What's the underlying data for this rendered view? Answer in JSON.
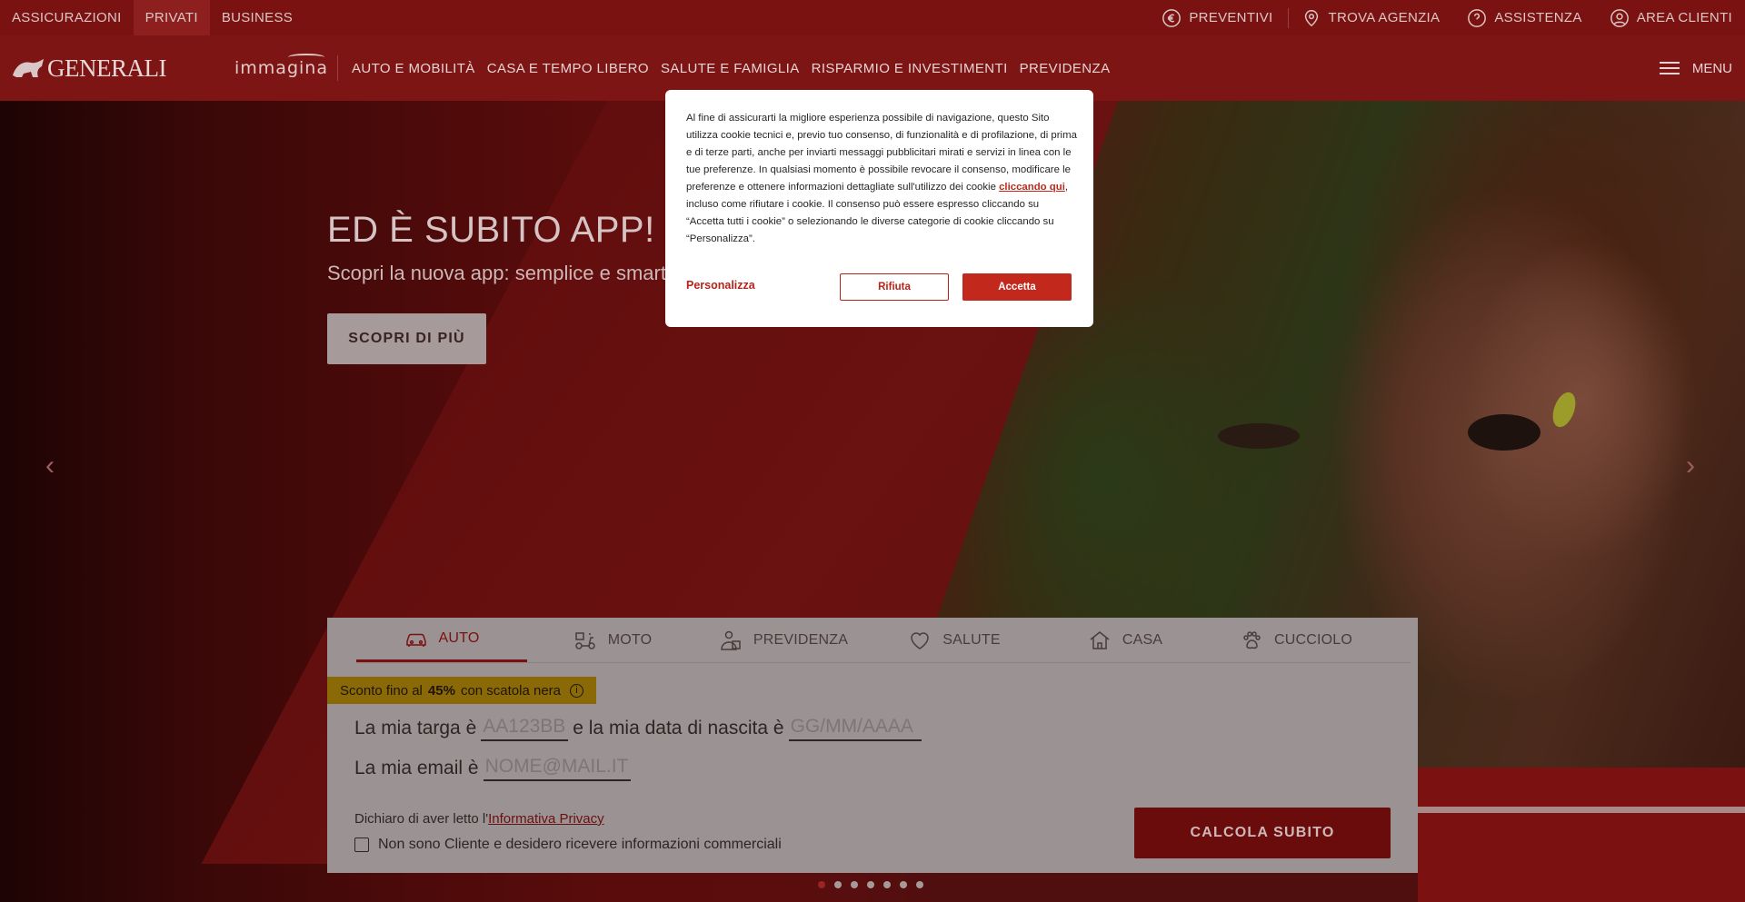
{
  "topbar": {
    "left": [
      "ASSICURAZIONI",
      "PRIVATI",
      "BUSINESS"
    ],
    "right": {
      "preventivi": "PREVENTIVI",
      "trova_agenzia": "TROVA AGENZIA",
      "assistenza": "ASSISTENZA",
      "area_clienti": "AREA CLIENTI"
    }
  },
  "nav": {
    "logo": "GENERALI",
    "immagina": "immagina",
    "links": [
      "AUTO E MOBILITÀ",
      "CASA E TEMPO LIBERO",
      "SALUTE E FAMIGLIA",
      "RISPARMIO E INVESTIMENTI",
      "PREVIDENZA"
    ],
    "menu": "MENU"
  },
  "hero": {
    "title": "ED È SUBITO APP!",
    "subtitle": "Scopri la nuova app: semplice e smart,",
    "cta": "SCOPRI DI PIÙ",
    "prev_arrow": "‹",
    "next_arrow": "›"
  },
  "quote": {
    "tabs": [
      "AUTO",
      "MOTO",
      "PREVIDENZA",
      "SALUTE",
      "CASA",
      "CUCCIOLO"
    ],
    "badge_pre": "Sconto fino al",
    "badge_value": "45%",
    "badge_post": "con scatola nera",
    "badge_info": "i",
    "line1_a": "La mia targa è",
    "plate_placeholder": "AA123BB",
    "line1_b": "e la mia data di nascita è",
    "date_placeholder": "GG/MM/AAAA",
    "line2_a": "La mia email è",
    "email_placeholder": "NOME@MAIL.IT",
    "privacy_text": "Dichiaro di aver letto l'",
    "privacy_link": "Informativa Privacy",
    "consent": "Non sono Cliente e desidero ricevere informazioni commerciali",
    "calc": "CALCOLA SUBITO"
  },
  "carousel": {
    "active_index": 0,
    "count": 7
  },
  "cookie": {
    "text_before": "Al fine di assicurarti la migliore esperienza possibile di navigazione, questo Sito utilizza cookie tecnici e, previo tuo consenso, di funzionalità e di profilazione, di prima e di terze parti, anche per inviarti messaggi pubblicitari mirati e servizi in linea con le tue preferenze. In qualsiasi momento è possibile revocare il consenso, modificare le preferenze e ottenere informazioni dettagliate sull'utilizzo dei cookie ",
    "link": "cliccando qui",
    "text_after": ", incluso come rifiutare i cookie. Il consenso può essere espresso cliccando su “Accetta tutti i cookie” o selezionando le diverse categorie di cookie cliccando su “Personalizza”.",
    "personalizza": "Personalizza",
    "rifiuta": "Rifiuta",
    "accetta": "Accetta"
  },
  "colors": {
    "brand_red": "#c2281b",
    "badge_yellow": "#e0ad10"
  }
}
